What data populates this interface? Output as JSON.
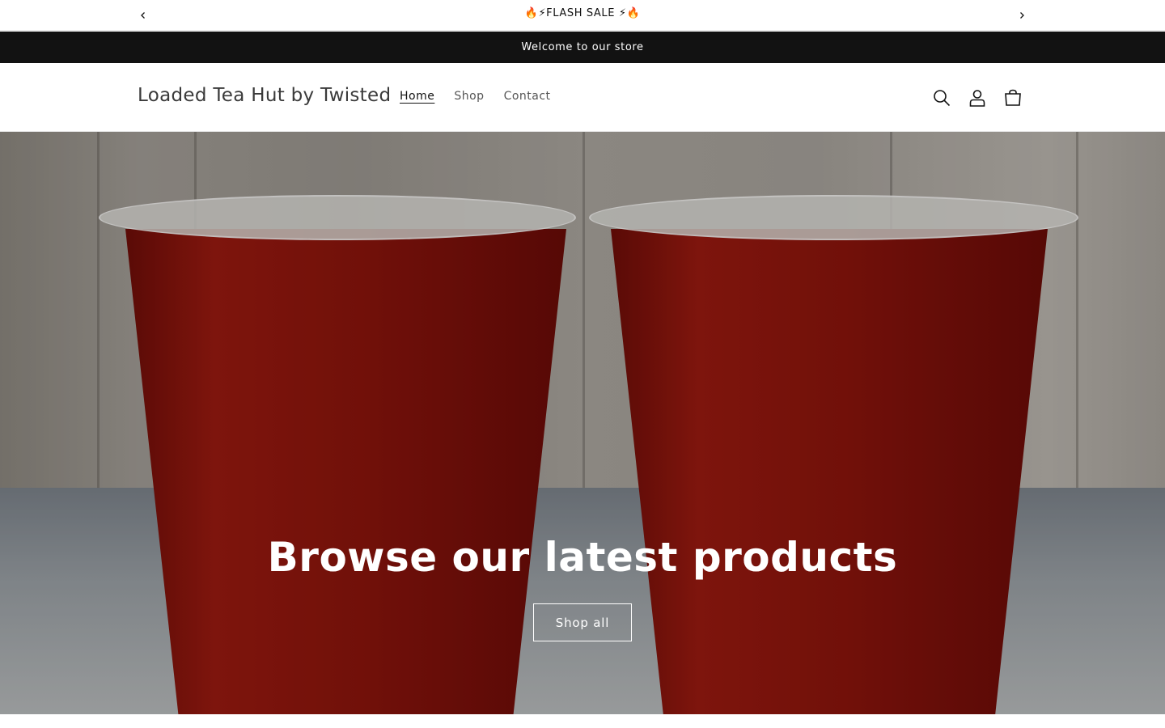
{
  "announcement": {
    "message": "🔥⚡FLASH SALE ⚡🔥",
    "prev_icon": "chevron-left-icon",
    "next_icon": "chevron-right-icon"
  },
  "welcome_bar": {
    "message": "Welcome to our store"
  },
  "header": {
    "logo": "Loaded Tea Hut by Twisted",
    "nav": [
      {
        "label": "Home",
        "active": true
      },
      {
        "label": "Shop",
        "active": false
      },
      {
        "label": "Contact",
        "active": false
      }
    ],
    "icons": [
      "search-icon",
      "account-icon",
      "cart-icon"
    ]
  },
  "hero": {
    "title": "Browse our latest products",
    "button_label": "Shop all"
  },
  "colors": {
    "dark_bar": "#121212",
    "text": "#121212",
    "muted_text": "#555555",
    "background": "#ffffff"
  }
}
